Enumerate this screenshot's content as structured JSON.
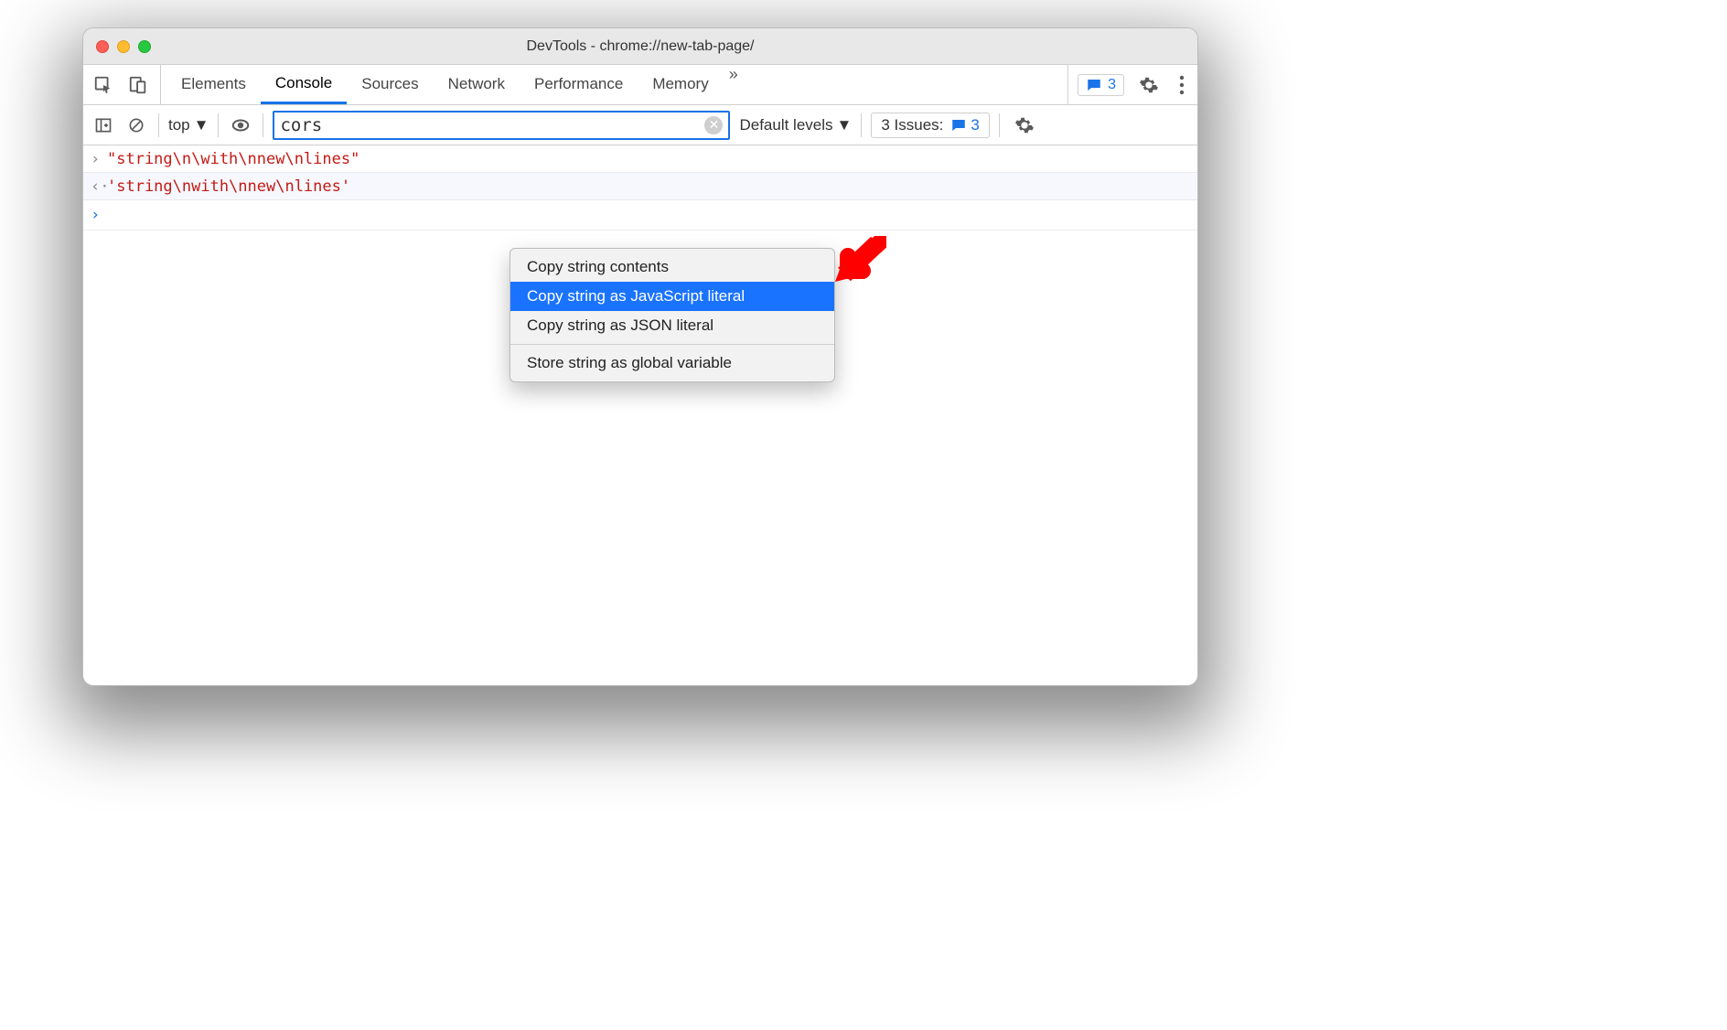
{
  "window": {
    "title": "DevTools - chrome://new-tab-page/"
  },
  "tabs": {
    "items": [
      "Elements",
      "Console",
      "Sources",
      "Network",
      "Performance",
      "Memory"
    ],
    "active": "Console",
    "overflow": "»"
  },
  "messages_badge": "3",
  "toolbar": {
    "context": "top",
    "filter_value": "cors",
    "levels": "Default levels",
    "issues_label": "3 Issues:",
    "issues_count": "3"
  },
  "console": {
    "line1": "\"string\\n\\with\\nnew\\nlines\"",
    "line2": "'string\\nwith\\nnew\\nlines'"
  },
  "context_menu": {
    "items": [
      "Copy string contents",
      "Copy string as JavaScript literal",
      "Copy string as JSON literal",
      "Store string as global variable"
    ],
    "highlighted": 1
  }
}
